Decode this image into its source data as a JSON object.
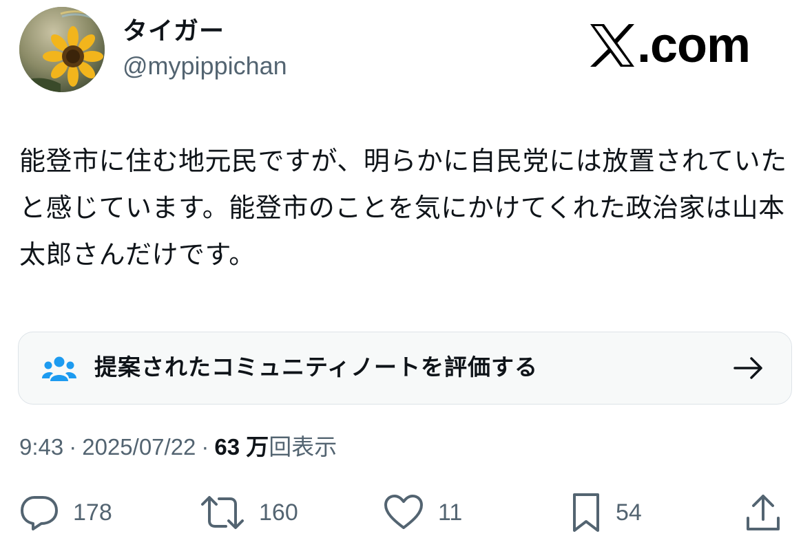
{
  "author": {
    "display_name": "タイガー",
    "handle": "@mypippichan",
    "avatar_icon": "sunflower-avatar"
  },
  "site": {
    "logo_text": ".com",
    "logo_icon": "x-logo-icon"
  },
  "tweet": {
    "text": "能登市に住む地元民ですが、明らかに自民党には放置されていたと感じています。能登市のことを気にかけてくれた政治家は山本太郎さんだけです。"
  },
  "community_note": {
    "label": "提案されたコミュニティノートを評価する",
    "icon": "people-icon",
    "arrow_icon": "arrow-right-icon",
    "accent": "#1d9bf0"
  },
  "meta": {
    "time": "9:43",
    "separator": "·",
    "date": "2025/07/22",
    "views_count": "63 万",
    "views_label": "回表示"
  },
  "actions": {
    "replies": "178",
    "reposts": "160",
    "likes": "11",
    "bookmarks": "54"
  },
  "colors": {
    "text": "#0f1419",
    "secondary": "#536471",
    "note_bg": "#f7f9f9",
    "note_border": "#dde3e8"
  }
}
